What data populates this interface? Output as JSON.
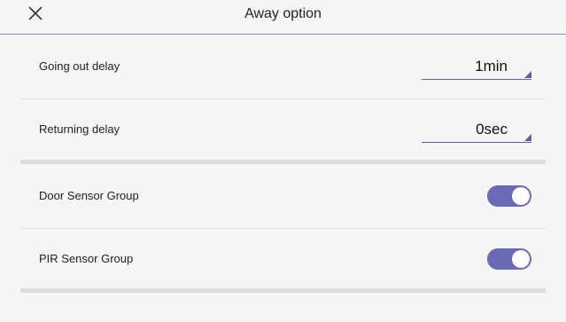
{
  "header": {
    "title": "Away option",
    "close_icon": "close-icon"
  },
  "delays": [
    {
      "label": "Going out delay",
      "value": "1min"
    },
    {
      "label": "Returning delay",
      "value": "0sec"
    }
  ],
  "sensors": [
    {
      "label": "Door Sensor Group",
      "enabled": true
    },
    {
      "label": "PIR Sensor Group",
      "enabled": true
    }
  ],
  "colors": {
    "accent": "#6a69b7",
    "background": "#f5f5f5",
    "divider": "#dcdcdc"
  }
}
